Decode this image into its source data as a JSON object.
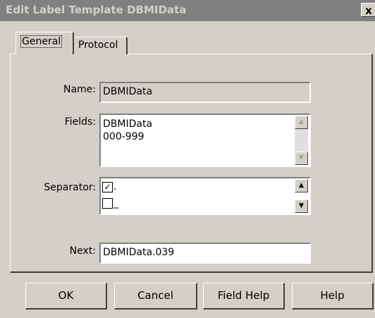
{
  "window": {
    "title": "Edit Label Template DBMIData",
    "close_glyph": "x"
  },
  "tabs": [
    {
      "label": "General",
      "active": true
    },
    {
      "label": "Protocol",
      "active": false
    }
  ],
  "form": {
    "name_label": "Name:",
    "name_value": "DBMIData",
    "fields_label": "Fields:",
    "fields_items": [
      "DBMIData",
      "000-999"
    ],
    "separator_label": "Separator:",
    "separator_items": [
      {
        "checked": true,
        "mark": "✓",
        "char": "."
      },
      {
        "checked": false,
        "mark": "",
        "char": "_"
      }
    ],
    "next_label": "Next:",
    "next_value": "DBMIData.039"
  },
  "buttons": {
    "ok": "OK",
    "cancel": "Cancel",
    "field_help": "Field Help",
    "help": "Help"
  },
  "icons": {
    "scroll_up": "▲",
    "scroll_down": "▼"
  }
}
